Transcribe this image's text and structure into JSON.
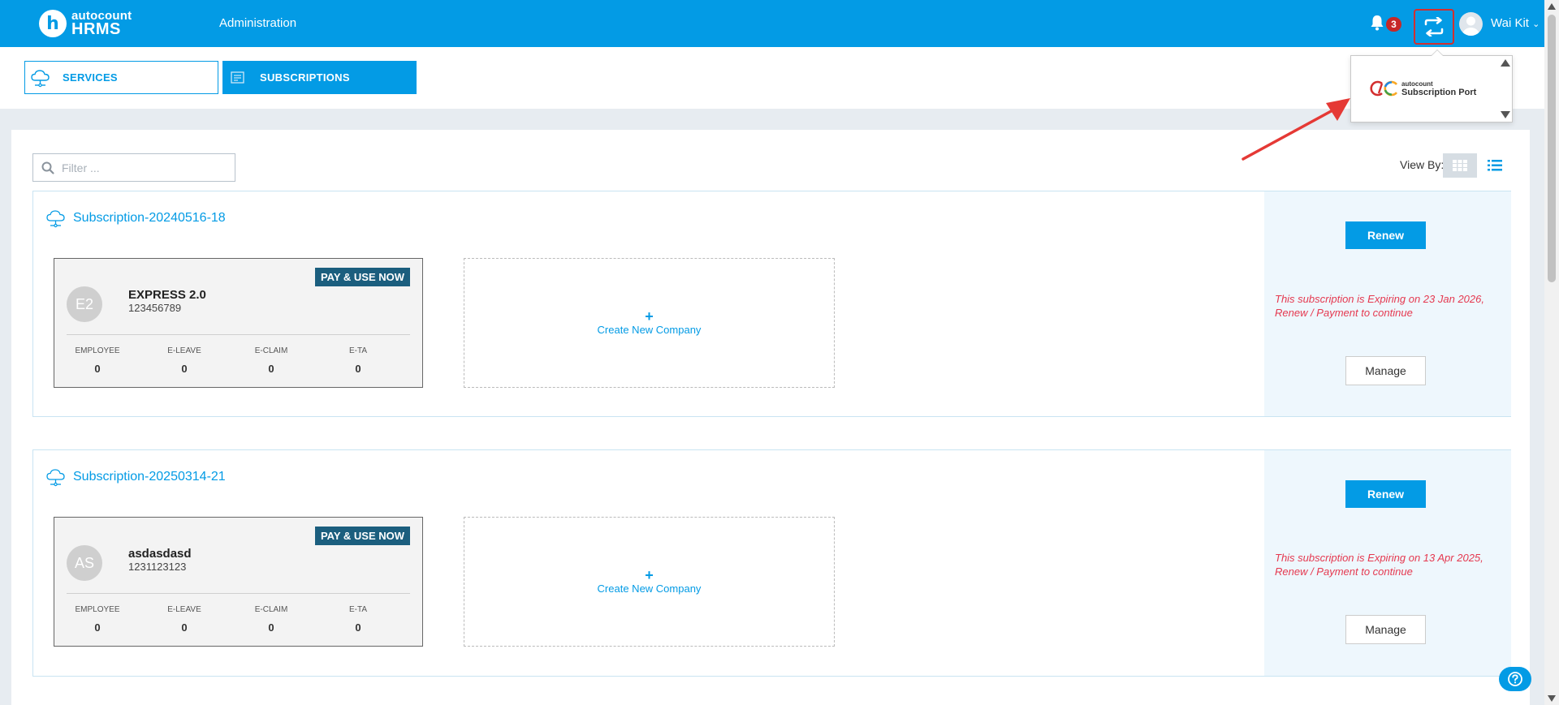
{
  "header": {
    "logo_small": "autocount",
    "logo_big": "HRMS",
    "logo_letter": "h",
    "nav": "Administration",
    "notification_count": "3",
    "user_name": "Wai Kit",
    "user_chevron": "⌄",
    "icons": [
      "bell-icon",
      "sync-icon",
      "user-avatar-icon",
      "chevron-down-icon"
    ]
  },
  "tabs": [
    {
      "label": "SERVICES",
      "active": false,
      "icon": "cloud-icon"
    },
    {
      "label": "SUBSCRIPTIONS",
      "active": true,
      "icon": "subscription-icon"
    }
  ],
  "dropdown": {
    "item_small": "autocount",
    "item_big": "Subscription Port"
  },
  "toolbar": {
    "filter_placeholder": "Filter ...",
    "view_by_label": "View By:"
  },
  "subscriptions": [
    {
      "title": "Subscription-20240516-18",
      "company": {
        "initials": "E2",
        "name": "EXPRESS 2.0",
        "id": "123456789",
        "badge": "PAY & USE NOW"
      },
      "stats": [
        {
          "label": "EMPLOYEE",
          "value": "0"
        },
        {
          "label": "E-LEAVE",
          "value": "0"
        },
        {
          "label": "E-CLAIM",
          "value": "0"
        },
        {
          "label": "E-TA",
          "value": "0"
        }
      ],
      "create_plus": "+",
      "create_label": "Create New Company",
      "renew_label": "Renew",
      "expiry_text": "This subscription is Expiring on 23 Jan 2026, Renew / Payment to continue",
      "manage_label": "Manage"
    },
    {
      "title": "Subscription-20250314-21",
      "company": {
        "initials": "AS",
        "name": "asdasdasd",
        "id": "1231123123",
        "badge": "PAY & USE NOW"
      },
      "stats": [
        {
          "label": "EMPLOYEE",
          "value": "0"
        },
        {
          "label": "E-LEAVE",
          "value": "0"
        },
        {
          "label": "E-CLAIM",
          "value": "0"
        },
        {
          "label": "E-TA",
          "value": "0"
        }
      ],
      "create_plus": "+",
      "create_label": "Create New Company",
      "renew_label": "Renew",
      "expiry_text": "This subscription is Expiring on 13 Apr 2025, Renew / Payment to continue",
      "manage_label": "Manage"
    }
  ],
  "colors": {
    "primary": "#039be5",
    "header_bg": "#039be5",
    "badge_dark": "#1b5e7e",
    "notification_red": "#c62828",
    "expiry_red": "#e53950",
    "annotation_red": "#e53935"
  }
}
